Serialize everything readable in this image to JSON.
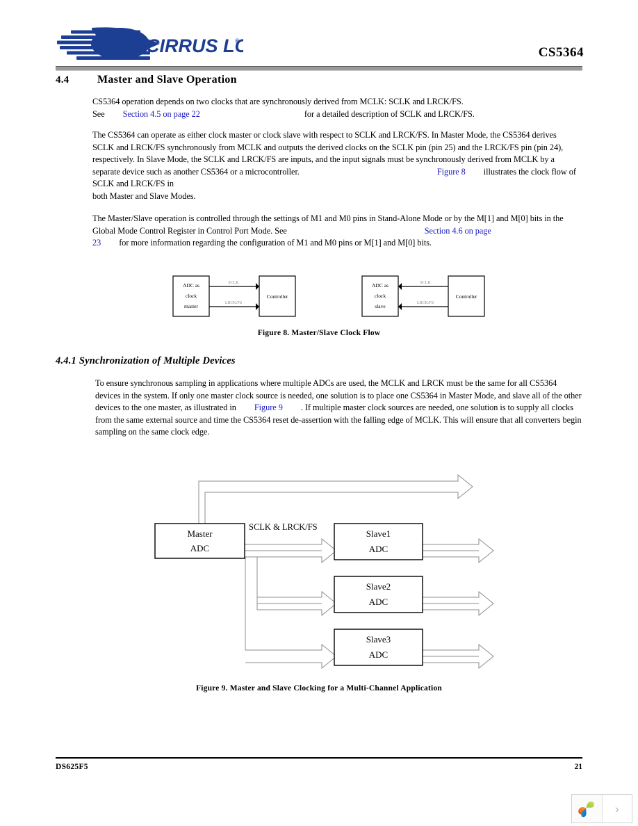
{
  "header": {
    "logo_text": "CIRRUS LOGIC",
    "logo_registered": "®",
    "doc_code": "CS5364"
  },
  "section": {
    "number": "4.4",
    "title": "Master and Slave Operation",
    "subsection_title": "4.4.1 Synchronization of Multiple Devices"
  },
  "paragraphs": {
    "p1_a": "CS5364 operation depends on two clocks that are synchronously derived from MCLK: SCLK and LRCK/FS.",
    "p1_b": "See",
    "p1_link": "Section 4.5 on page 22",
    "p1_c": "for a detailed description of SCLK and LRCK/FS.",
    "p2_a": "The CS5364 can operate as either clock master or clock slave with respect to SCLK and LRCK/FS. In Master Mode, the CS5364 derives SCLK and LRCK/FS synchronously from MCLK and outputs the derived clocks on the SCLK pin (pin 25) and the LRCK/FS pin (pin 24), respectively. In Slave Mode, the SCLK and LRCK/FS are inputs, and the input signals must be synchronously derived from MCLK by a separate device such as another CS5364 or a microcontroller.",
    "p2_link": "Figure 8",
    "p2_b": "illustrates the clock flow of SCLK and LRCK/FS in",
    "p2_c": "both Master and Slave Modes.",
    "p3_a": "The Master/Slave operation is controlled through the settings of M1 and M0 pins in Stand-Alone Mode or by the M[1] and M[0] bits in the Global Mode Control Register in Control Port Mode. See",
    "p3_link1": "Section 4.6 on page",
    "p3_link2": "23",
    "p3_b": "for more information regarding the configuration of M1 and M0 pins or M[1] and M[0] bits.",
    "p4_a": "To ensure synchronous sampling in applications where multiple ADCs are used, the MCLK and LRCK must be the same for all CS5364 devices in the system. If only one master clock source is needed, one solution is to place one CS5364 in Master Mode, and slave all of the other devices to the one master, as illustrated in",
    "p4_link": "Figure 9",
    "p4_b": ". If multiple master clock sources are needed, one solution is to supply all clocks from the same external source and time the CS5364 reset de-assertion with the falling edge of MCLK. This will ensure that all converters begin sampling on the same clock edge."
  },
  "figure8": {
    "caption": "Figure 8.  Master/Slave Clock Flow",
    "left": {
      "source_label_line1": "ADC as",
      "source_label_line2": "clock",
      "source_label_line3": "master",
      "target_label": "Controller",
      "signal_top": "SCLK",
      "signal_bottom": "LRCK/FS",
      "direction": "left-to-right"
    },
    "right": {
      "source_label_line1": "ADC as",
      "source_label_line2": "clock",
      "source_label_line3": "slave",
      "target_label": "Controller",
      "signal_top": "SCLK",
      "signal_bottom": "LRCK/FS",
      "direction": "right-to-left"
    }
  },
  "figure9": {
    "caption": "Figure 9.  Master and Slave Clocking for a Multi-Channel Application",
    "bus_label": "SCLK & LRCK/FS",
    "blocks": [
      {
        "line1": "Master",
        "line2": "ADC"
      },
      {
        "line1": "Slave1",
        "line2": "ADC"
      },
      {
        "line1": "Slave2",
        "line2": "ADC"
      },
      {
        "line1": "Slave3",
        "line2": "ADC"
      }
    ]
  },
  "footer": {
    "doc_number": "DS625F5",
    "page_number": "21"
  },
  "colors": {
    "link": "#1a1ac0",
    "rule": "#9a9a9a",
    "logo_blue": "#1c3f94",
    "diagram_line": "#8c8c8c"
  }
}
